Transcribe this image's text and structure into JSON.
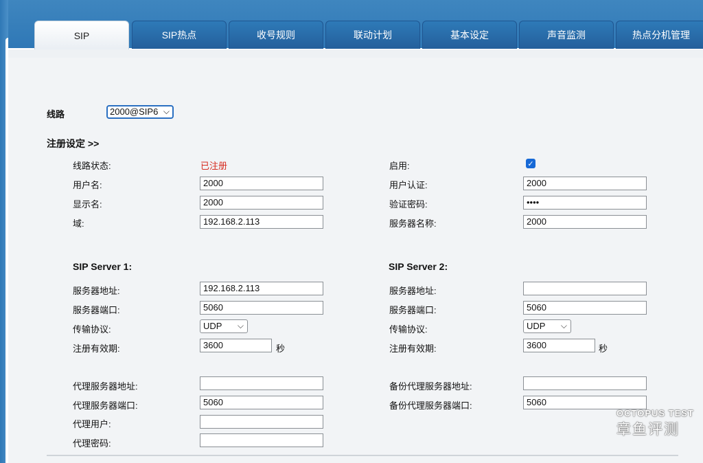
{
  "tabs": [
    "SIP",
    "SIP热点",
    "收号规则",
    "联动计划",
    "基本设定",
    "声音监测",
    "热点分机管理"
  ],
  "line": {
    "label": "线路",
    "value": "2000@SIP6"
  },
  "register": {
    "header": "注册设定 >>",
    "line_status_label": "线路状态:",
    "line_status_value": "已注册",
    "status_color": "#d62b1f",
    "username_label": "用户名:",
    "username_value": "2000",
    "display_label": "显示名:",
    "display_value": "2000",
    "domain_label": "域:",
    "domain_value": "192.168.2.113",
    "enable_label": "启用:",
    "enable_checked": true,
    "auth_user_label": "用户认证:",
    "auth_user_value": "2000",
    "password_label": "验证密码:",
    "password_value": "••••",
    "server_name_label": "服务器名称:",
    "server_name_value": "2000"
  },
  "server1": {
    "title": "SIP Server 1:",
    "addr_label": "服务器地址:",
    "addr_value": "192.168.2.113",
    "port_label": "服务器端口:",
    "port_value": "5060",
    "transport_label": "传输协议:",
    "transport_value": "UDP",
    "expire_label": "注册有效期:",
    "expire_value": "3600",
    "unit": "秒"
  },
  "server2": {
    "title": "SIP Server 2:",
    "addr_label": "服务器地址:",
    "addr_value": "",
    "port_label": "服务器端口:",
    "port_value": "5060",
    "transport_label": "传输协议:",
    "transport_value": "UDP",
    "expire_label": "注册有效期:",
    "expire_value": "3600",
    "unit": "秒"
  },
  "proxy": {
    "addr_label": "代理服务器地址:",
    "addr_value": "",
    "port_label": "代理服务器端口:",
    "port_value": "5060",
    "user_label": "代理用户:",
    "user_value": "",
    "pass_label": "代理密码:",
    "pass_value": "",
    "backup_addr_label": "备份代理服务器地址:",
    "backup_addr_value": "",
    "backup_port_label": "备份代理服务器端口:",
    "backup_port_value": "5060"
  },
  "watermark": {
    "en": "OCTOPUS TEST",
    "cn": "章鱼评测"
  },
  "colors": {
    "tab_blue": "#2e7ab8",
    "band_blue": "#3f86bf"
  }
}
